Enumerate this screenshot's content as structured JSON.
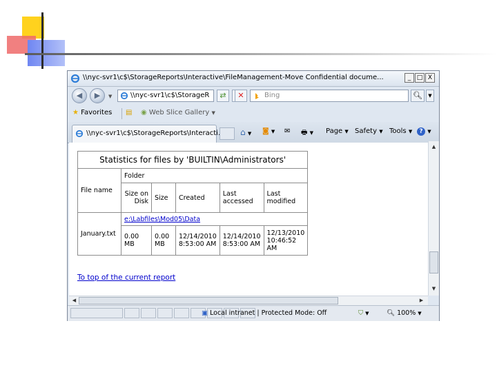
{
  "window": {
    "title": "\\\\nyc-svr1\\c$\\StorageReports\\Interactive\\FileManagement-Move Confidential docume...",
    "controls": {
      "minimize": "_",
      "maximize": "□",
      "close": "X"
    }
  },
  "address": {
    "url": "\\\\nyc-svr1\\c$\\StorageR",
    "search_placeholder": "Bing"
  },
  "favorites": {
    "favorites_label": "Favorites",
    "web_slice_label": "Web Slice Gallery"
  },
  "tab": {
    "title": "\\\\nyc-svr1\\c$\\StorageReports\\Interacti..."
  },
  "commands": {
    "page": "Page",
    "safety": "Safety",
    "tools": "Tools"
  },
  "report": {
    "title": "Statistics for files by 'BUILTIN\\Administrators'",
    "headers": {
      "folder": "Folder",
      "file_name": "File name",
      "size_on_disk": "Size on Disk",
      "size": "Size",
      "created": "Created",
      "last_accessed": "Last accessed",
      "last_modified": "Last modified"
    },
    "folder_path": "e:\\Labfiles\\Mod05\\Data",
    "rows": [
      {
        "file_name": "January.txt",
        "size_on_disk": "0.00 MB",
        "size": "0.00 MB",
        "created": "12/14/2010 8:53:00 AM",
        "last_accessed": "12/14/2010 8:53:00 AM",
        "last_modified": "12/13/2010 10:46:52 AM"
      }
    ],
    "top_link": "To top of the current report"
  },
  "status": {
    "zone": "Local intranet | Protected Mode: Off",
    "zoom": "100%"
  },
  "colors": {
    "slide_yellow": "#ffd21e",
    "slide_red": "#ef6a6a",
    "slide_blue": "#6f86f2",
    "link": "#0000cc"
  }
}
